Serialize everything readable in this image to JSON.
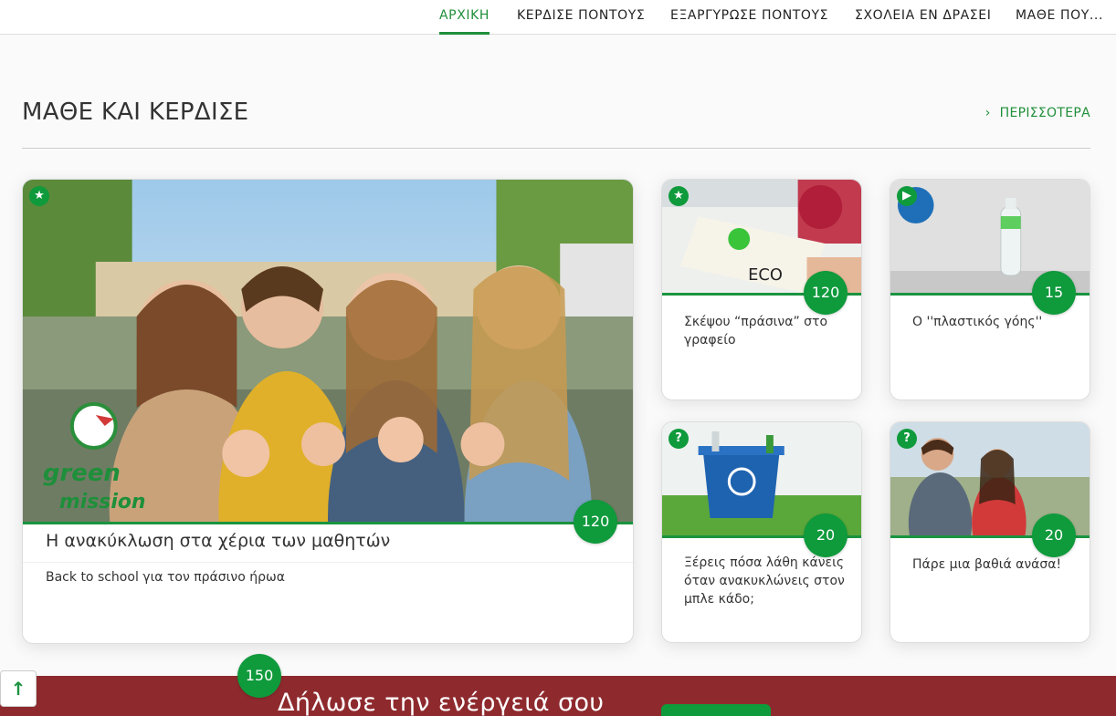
{
  "nav": {
    "items": [
      {
        "label": "ΑΡΧΙΚΗ",
        "active": true
      },
      {
        "label": "ΚΕΡΔΙΣΕ ΠΟΝΤΟΥΣ"
      },
      {
        "label": "ΕΞΑΡΓΥΡΩΣΕ ΠΟΝΤΟΥΣ"
      },
      {
        "label": "ΣΧΟΛΕΙΑ ΕΝ ΔΡΑΣΕΙ"
      },
      {
        "label": "ΜΑΘΕ ΠΟΥ..."
      }
    ]
  },
  "section": {
    "title": "ΜΑΘΕ ΚΑΙ ΚΕΡΔΙΣΕ",
    "more_label": "ΠΕΡΙΣΣΟΤΕΡΑ"
  },
  "featured": {
    "title": "Η ανακύκλωση στα χέρια των μαθητών",
    "subtitle": "Back to school για τον πράσινο ήρωα",
    "points": "120",
    "badge_icon": "star-icon",
    "logo_text": [
      "green",
      "mission"
    ]
  },
  "cards": [
    {
      "title": "Σκέψου “πράσινα” στο γραφείο",
      "points": "120",
      "badge_icon": "star-icon",
      "image_text": "ECO"
    },
    {
      "title": "Ο ''πλαστικός γόης''",
      "points": "15",
      "badge_icon": "video-icon"
    },
    {
      "title": "Ξέρεις πόσα λάθη κάνεις όταν ανακυκλώνεις στον μπλε κάδο;",
      "points": "20",
      "badge_icon": "question-icon"
    },
    {
      "title": "Πάρε μια βαθιά ανάσα!",
      "points": "20",
      "badge_icon": "question-icon"
    }
  ],
  "banner": {
    "title": "Δήλωσε την ενέργειά σου",
    "points": "150"
  },
  "colors": {
    "brand_green": "#0f9a3c",
    "banner_red": "#8e2a2e"
  }
}
